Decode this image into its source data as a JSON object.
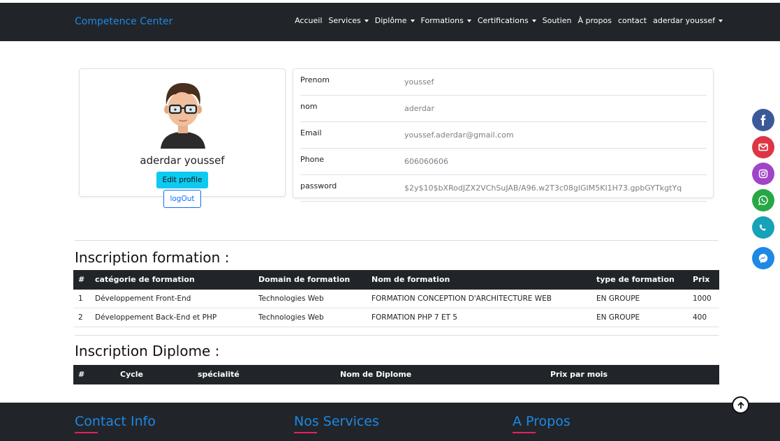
{
  "navbar": {
    "brand": "Competence Center",
    "items": [
      {
        "label": "Accueil",
        "dropdown": false
      },
      {
        "label": "Services",
        "dropdown": true
      },
      {
        "label": "Diplôme",
        "dropdown": true
      },
      {
        "label": "Formations",
        "dropdown": true
      },
      {
        "label": "Certifications",
        "dropdown": true
      },
      {
        "label": "Soutien",
        "dropdown": false
      },
      {
        "label": "À propos",
        "dropdown": false
      },
      {
        "label": "contact",
        "dropdown": false
      },
      {
        "label": "aderdar youssef",
        "dropdown": true
      }
    ]
  },
  "profile": {
    "name": "aderdar youssef",
    "edit_label": "Edit profile",
    "logout_label": "logOut"
  },
  "info": {
    "rows": [
      {
        "label": "Prenom",
        "value": "youssef"
      },
      {
        "label": "nom",
        "value": "aderdar"
      },
      {
        "label": "Email",
        "value": "youssef.aderdar@gmail.com"
      },
      {
        "label": "Phone",
        "value": "606060606"
      },
      {
        "label": "password",
        "value": "$2y$10$bXRodJZX2VChSuJAB/A96.w2T3c08glGIM5KI1H73.gpbGYTkgtYq"
      }
    ]
  },
  "formation": {
    "title": "Inscription formation :",
    "headers": [
      "#",
      "catégorie de formation",
      "Domain de formation",
      "Nom de formation",
      "type de formation",
      "Prix"
    ],
    "rows": [
      [
        "1",
        "Développement Front-End",
        "Technologies Web",
        "FORMATION CONCEPTION D'ARCHITECTURE WEB",
        "EN GROUPE",
        "1000"
      ],
      [
        "2",
        "Développement Back-End et PHP",
        "Technologies Web",
        "FORMATION PHP 7 ET 5",
        "EN GROUPE",
        "400"
      ]
    ]
  },
  "diplome": {
    "title": "Inscription Diplome :",
    "headers": [
      "#",
      "Cycle",
      "spécialité",
      "Nom de Diplome",
      "Prix par mois"
    ]
  },
  "social": [
    {
      "icon": "facebook-icon",
      "color": "#3b5998"
    },
    {
      "icon": "mail-icon",
      "color": "#dc3545"
    },
    {
      "icon": "instagram-icon",
      "color": "#a044c8"
    },
    {
      "icon": "whatsapp-icon",
      "color": "#28a745"
    },
    {
      "icon": "phone-icon",
      "color": "#17a2b8"
    },
    {
      "icon": "messenger-icon",
      "color": "#1e88e5"
    }
  ],
  "footer": {
    "col1": "Contact Info",
    "col2": "Nos Services",
    "col3": "A Propos"
  },
  "colors": {
    "dark": "#212529",
    "brand_blue": "#1e88e5",
    "accent_pink": "#e91e63",
    "edit_button": "#0dcaf0"
  }
}
